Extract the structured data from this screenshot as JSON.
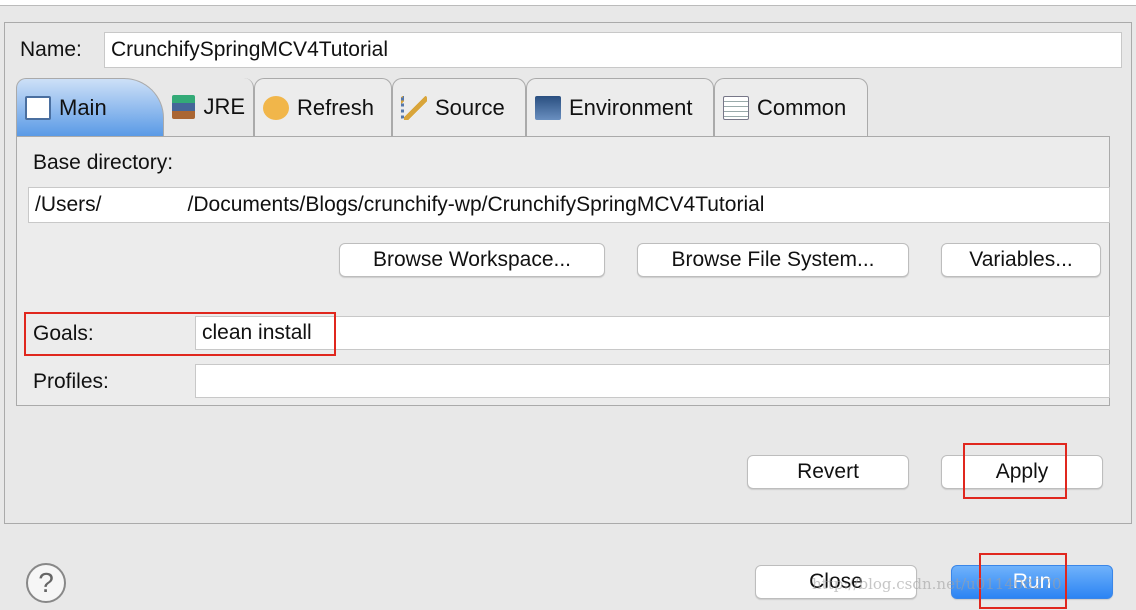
{
  "name": {
    "label": "Name:",
    "value": "CrunchifySpringMCV4Tutorial"
  },
  "tabs": [
    {
      "label": "Main",
      "icon": "main-tab-icon",
      "active": true
    },
    {
      "label": "JRE",
      "icon": "library-books-icon"
    },
    {
      "label": "Refresh",
      "icon": "refresh-icon"
    },
    {
      "label": "Source",
      "icon": "source-tree-icon"
    },
    {
      "label": "Environment",
      "icon": "environment-icon"
    },
    {
      "label": "Common",
      "icon": "table-icon"
    }
  ],
  "main": {
    "base_directory_label": "Base directory:",
    "base_directory_prefix": "/Users/",
    "base_directory_hidden": "",
    "base_directory_suffix": "/Documents/Blogs/crunchify-wp/CrunchifySpringMCV4Tutorial",
    "browse_workspace": "Browse Workspace...",
    "browse_file_system": "Browse File System...",
    "variables": "Variables...",
    "goals_label": "Goals:",
    "goals_value": "clean install",
    "profiles_label": "Profiles:",
    "profiles_value": ""
  },
  "buttons": {
    "revert": "Revert",
    "apply": "Apply",
    "close": "Close",
    "run": "Run",
    "help": "?"
  },
  "colors": {
    "highlight": "#e0271e",
    "primary": "#2c84f3"
  },
  "watermark": "http://blog.csdn.net/u011408270"
}
